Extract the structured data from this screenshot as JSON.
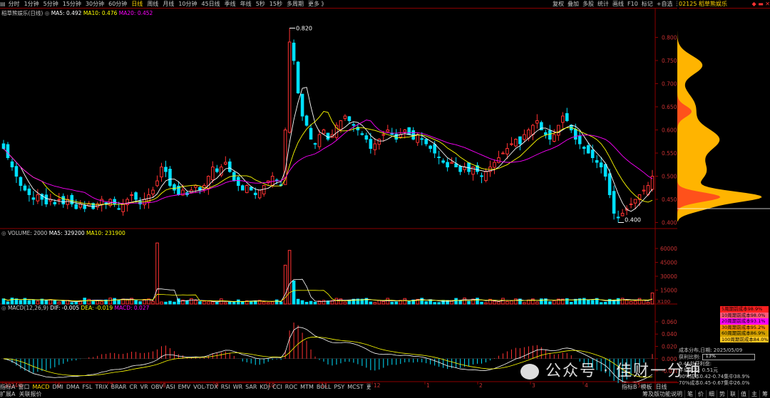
{
  "toolbar": {
    "periods": [
      "分时",
      "1分钟",
      "5分钟",
      "15分钟",
      "30分钟",
      "60分钟",
      "日线",
      "周线",
      "月线",
      "10分钟",
      "45日线",
      "季线",
      "年线",
      "5秒",
      "15秒",
      "多周期",
      "更多 》"
    ],
    "active_period": "日线",
    "right_buttons": [
      "复权",
      "叠加",
      "多股",
      "统计",
      "画线",
      "F10",
      "标记",
      "+自选",
      "返回"
    ]
  },
  "stock": {
    "title_right": "02125 稻草熊娱乐",
    "price_legend": {
      "name": "稻草熊娱乐(日线)",
      "ma5": "MA5: 0.492",
      "ma10": "MA10: 0.476",
      "ma20": "MA20: 0.452"
    },
    "high_mark": "0.820",
    "low_mark": "0.400"
  },
  "price_axis": [
    "0.800",
    "0.750",
    "0.700",
    "0.650",
    "0.600",
    "0.550",
    "0.500",
    "0.450",
    "0.400"
  ],
  "volume_legend": {
    "name": "VOLUME: 2000",
    "ma5": "MA5: 329200",
    "ma10": "MA10: 231900"
  },
  "volume_axis": [
    "60000",
    "45000",
    "30000",
    "15000",
    "X100"
  ],
  "macd_legend": {
    "name": "MACD(12,26,9)",
    "dif": "DIF: -0.005",
    "dea": "DEA: -0.019",
    "macd": "MACD: 0.027"
  },
  "macd_axis": [
    "0.060",
    "0.040",
    "0.020",
    "0.000",
    "-0.020"
  ],
  "date_axis": [
    "2024年",
    "6",
    "7",
    "8",
    "9",
    "10",
    "11",
    "12",
    "1",
    "2",
    "3",
    "4",
    "5"
  ],
  "indicator_tabs": [
    "指标A",
    "窗口",
    "MACD",
    "DMI",
    "DMA",
    "FSL",
    "TRIX",
    "BRAR",
    "CR",
    "VR",
    "OBV",
    "ASI",
    "EMV",
    "VOL-TDX",
    "RSI",
    "WR",
    "SAR",
    "KDJ",
    "CCI",
    "ROC",
    "MTM",
    "BOLL",
    "PSY",
    "MCST",
    "更多",
    "设置"
  ],
  "bottom_left": [
    "扩展A",
    "关联报价"
  ],
  "bottom_mid": [
    "指标B",
    "模板",
    "日线"
  ],
  "bottom_right": [
    "筹及版功能说明",
    "笔",
    "价",
    "细",
    "势",
    "联",
    "值",
    "主",
    "筹"
  ],
  "cost_legend": [
    {
      "label": "5周期前成本98.9%",
      "color": "#ff2020"
    },
    {
      "label": "10周期前成本98.0%",
      "color": "#ff5a78"
    },
    {
      "label": "20周期前成本93.1%",
      "color": "#ff00ff"
    },
    {
      "label": "30周期前成本95.2%",
      "color": "#ff8c00"
    },
    {
      "label": "60周期前成本86.9%",
      "color": "#d2a000"
    },
    {
      "label": "100周期前成本84.0%",
      "color": "#ffc820"
    }
  ],
  "cost_info": {
    "line1": "成本分布,日期: 2025/05/09",
    "profit_label": "获利比例:",
    "profit_value": "13%",
    "line3": "0.45处获利盘:",
    "line4": "平均成本: 0.51元",
    "line5": "90%成本0.42-0.74集中38.9%",
    "line6": "70%成本0.45-0.67集中26.0%"
  },
  "watermark": "公众号 · 佳财一分钟",
  "colors": {
    "up": "#ff3232",
    "down": "#00e0ff",
    "ma5": "#ffffff",
    "ma10": "#ffff00",
    "ma20": "#ff00ff",
    "chip": "#ffb400"
  },
  "chart_data": {
    "type": "candlestick",
    "x_range": [
      "2024-06",
      "2025-05"
    ],
    "price": {
      "ylim": [
        0.39,
        0.83
      ],
      "ticks": [
        0.4,
        0.45,
        0.5,
        0.55,
        0.6,
        0.65,
        0.7,
        0.75,
        0.8
      ],
      "close": [
        0.56,
        0.54,
        0.52,
        0.5,
        0.48,
        0.47,
        0.46,
        0.45,
        0.46,
        0.45,
        0.44,
        0.45,
        0.44,
        0.45,
        0.44,
        0.45,
        0.44,
        0.43,
        0.44,
        0.43,
        0.44,
        0.43,
        0.44,
        0.45,
        0.44,
        0.45,
        0.44,
        0.43,
        0.44,
        0.45,
        0.46,
        0.45,
        0.44,
        0.45,
        0.46,
        0.47,
        0.49,
        0.52,
        0.51,
        0.48,
        0.47,
        0.46,
        0.47,
        0.46,
        0.47,
        0.48,
        0.47,
        0.48,
        0.5,
        0.52,
        0.51,
        0.52,
        0.53,
        0.51,
        0.49,
        0.48,
        0.47,
        0.48,
        0.47,
        0.46,
        0.47,
        0.48,
        0.49,
        0.5,
        0.49,
        0.48,
        0.6,
        0.79,
        0.75,
        0.68,
        0.63,
        0.61,
        0.58,
        0.57,
        0.59,
        0.6,
        0.58,
        0.59,
        0.61,
        0.62,
        0.63,
        0.62,
        0.61,
        0.6,
        0.59,
        0.58,
        0.56,
        0.57,
        0.58,
        0.59,
        0.6,
        0.59,
        0.58,
        0.59,
        0.6,
        0.59,
        0.58,
        0.59,
        0.58,
        0.57,
        0.56,
        0.55,
        0.54,
        0.53,
        0.52,
        0.53,
        0.52,
        0.51,
        0.52,
        0.51,
        0.52,
        0.51,
        0.5,
        0.51,
        0.52,
        0.53,
        0.54,
        0.55,
        0.56,
        0.57,
        0.58,
        0.57,
        0.59,
        0.6,
        0.61,
        0.62,
        0.6,
        0.59,
        0.58,
        0.59,
        0.61,
        0.63,
        0.62,
        0.6,
        0.58,
        0.57,
        0.56,
        0.55,
        0.54,
        0.53,
        0.52,
        0.5,
        0.46,
        0.42,
        0.41,
        0.42,
        0.43,
        0.44,
        0.45,
        0.46,
        0.47,
        0.48,
        0.5
      ],
      "high_point": {
        "value": 0.82,
        "label": "0.820"
      },
      "low_point": {
        "value": 0.4,
        "label": "0.400"
      }
    },
    "volume": {
      "ylim": [
        0,
        70000
      ],
      "ticks": [
        15000,
        30000,
        45000,
        60000
      ],
      "unit": "X100"
    },
    "macd": {
      "ylim": [
        -0.035,
        0.075
      ],
      "ticks": [
        -0.02,
        0.0,
        0.02,
        0.04,
        0.06
      ]
    }
  }
}
